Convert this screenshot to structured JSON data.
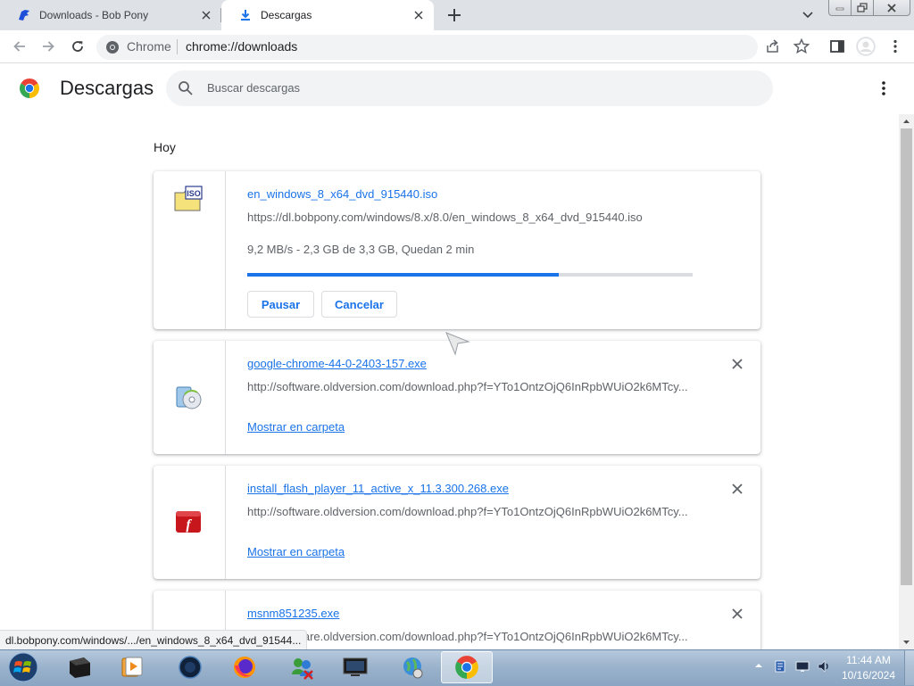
{
  "tabs": [
    {
      "title": "Downloads - Bob Pony",
      "active": false
    },
    {
      "title": "Descargas",
      "active": true
    }
  ],
  "omnibox": {
    "site_label": "Chrome",
    "url": "chrome://downloads"
  },
  "page": {
    "title": "Descargas",
    "search_placeholder": "Buscar descargas",
    "date_header": "Hoy"
  },
  "downloads": [
    {
      "name": "en_windows_8_x64_dvd_915440.iso",
      "url": "https://dl.bobpony.com/windows/8.x/8.0/en_windows_8_x64_dvd_915440.iso",
      "status": "9,2 MB/s - 2,3 GB de 3,3 GB, Quedan 2 min",
      "progress": 0.7,
      "pause_label": "Pausar",
      "cancel_label": "Cancelar",
      "icon": "iso-file-icon"
    },
    {
      "name": "google-chrome-44-0-2403-157.exe",
      "url": "http://software.oldversion.com/download.php?f=YTo1OntzOjQ6InRpbWUiO2k6MTcy...",
      "link": "Mostrar en carpeta",
      "icon": "installer-cd-icon"
    },
    {
      "name": "install_flash_player_11_active_x_11.3.300.268.exe",
      "url": "http://software.oldversion.com/download.php?f=YTo1OntzOjQ6InRpbWUiO2k6MTcy...",
      "link": "Mostrar en carpeta",
      "icon": "flash-player-icon"
    },
    {
      "name": "msnm851235.exe",
      "url": "http://software.oldversion.com/download.php?f=YTo1OntzOjQ6InRpbWUiO2k6MTcy...",
      "icon": "exe-file-icon"
    }
  ],
  "status_bubble": "dl.bobpony.com/windows/.../en_windows_8_x64_dvd_91544...",
  "taskbar": {
    "apps": [
      "windows-media-center",
      "windows-media-player",
      "dark-circle-app",
      "firefox",
      "windows-live-messenger",
      "media-center-monitor",
      "internet-globe",
      "google-chrome"
    ],
    "clock_time": "11:44 AM",
    "clock_date": "10/16/2024"
  },
  "colors": {
    "accent": "#1a73e8",
    "tabstrip": "#dee1e6",
    "taskbar": "#9bb3cc"
  }
}
